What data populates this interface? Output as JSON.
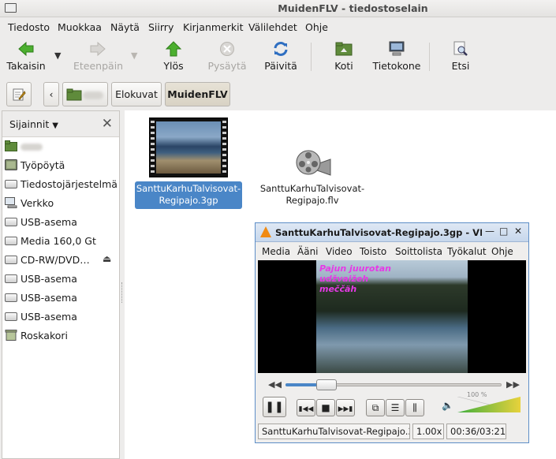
{
  "window": {
    "title": "MuidenFLV - tiedostoselain"
  },
  "menubar": [
    "Tiedosto",
    "Muokkaa",
    "Näytä",
    "Siirry",
    "Kirjanmerkit",
    "Välilehdet",
    "Ohje"
  ],
  "toolbar": {
    "back": "Takaisin",
    "forward": "Eteenpäin",
    "up": "Ylös",
    "stop": "Pysäytä",
    "reload": "Päivitä",
    "home": "Koti",
    "computer": "Tietokone",
    "search": "Etsi"
  },
  "pathbar": {
    "crumbs": [
      "Elokuvat",
      "MuidenFLV"
    ]
  },
  "sidebar": {
    "selector": "Sijainnit",
    "items": [
      {
        "label": "",
        "icon": "home-folder-icon"
      },
      {
        "label": "Työpöytä",
        "icon": "desktop-icon"
      },
      {
        "label": "Tiedostojärjestelmä",
        "icon": "drive-icon"
      },
      {
        "label": "Verkko",
        "icon": "network-icon"
      },
      {
        "label": "USB-asema",
        "icon": "drive-icon"
      },
      {
        "label": "Media 160,0 Gt",
        "icon": "drive-icon"
      },
      {
        "label": "CD-RW/DVD…",
        "icon": "optical-drive-icon"
      },
      {
        "label": "USB-asema",
        "icon": "drive-icon"
      },
      {
        "label": "USB-asema",
        "icon": "drive-icon"
      },
      {
        "label": "USB-asema",
        "icon": "drive-icon"
      },
      {
        "label": "Roskakori",
        "icon": "trash-icon"
      }
    ]
  },
  "files": [
    {
      "name": "SanttuKarhuTalvisovat-Regipajo.3gp",
      "selected": true
    },
    {
      "name": "SanttuKarhuTalvisovat-Regipajo.flv",
      "selected": false
    }
  ],
  "vlc": {
    "title": "SanttuKarhuTalvisovat-Regipajo.3gp - VL",
    "menu": [
      "Media",
      "Ääni",
      "Video",
      "Toisto",
      "Soittolista",
      "Työkalut",
      "Ohje"
    ],
    "subtitle": "Pajun juurotan udžvaižeh meččäh",
    "progress": 0.19,
    "volume_label": "100 %",
    "volume": 1.0,
    "status_file": "SanttuKarhuTalvisovat-Regipajo.3gp",
    "speed": "1.00x",
    "time": "00:36/03:21",
    "accent": "#4a86c7"
  }
}
